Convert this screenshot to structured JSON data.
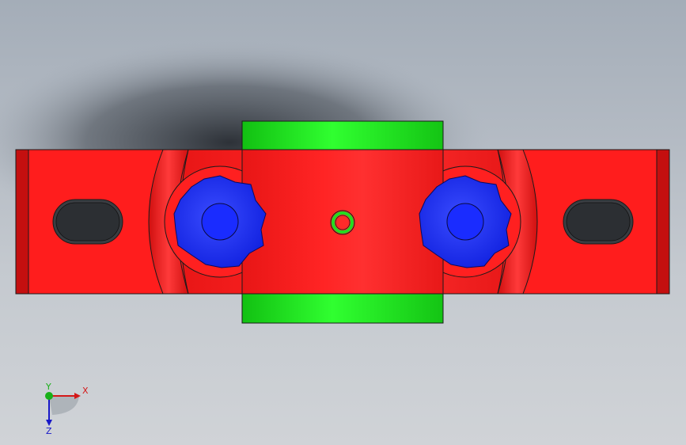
{
  "viewport": {
    "background_top": "#a4adb8",
    "background_bottom": "#d0d3d7"
  },
  "model": {
    "base_color": "#ff1d1d",
    "base_edge_color": "#c40f0f",
    "shaft_color": "#22ee22",
    "bolt_color": "#1a2cff",
    "outline_color": "#1a1a1a"
  },
  "triad": {
    "x_label": "X",
    "y_label": "Y",
    "z_label": "Z",
    "x_color": "#d41818",
    "y_color": "#18b018",
    "z_color": "#1818c8"
  }
}
